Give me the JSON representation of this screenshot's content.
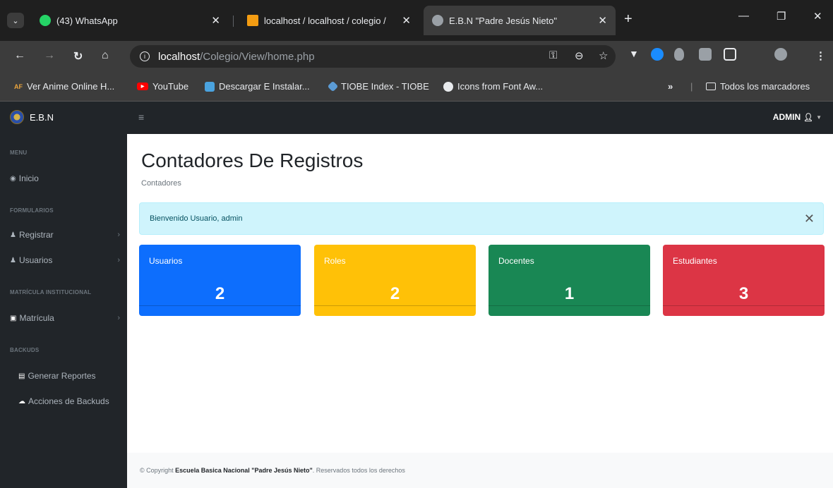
{
  "browser": {
    "tabs": [
      {
        "title": "(43) WhatsApp",
        "favicon_color": "#25d366"
      },
      {
        "title": "localhost / localhost / colegio /",
        "favicon_color": "#f39c12"
      },
      {
        "title": "E.B.N \"Padre Jesús Nieto\"",
        "favicon_color": "#9aa0a6"
      }
    ],
    "url_host": "localhost",
    "url_path": "/Colegio/View/home.php",
    "bookmarks": [
      {
        "label": "Ver Anime Online H...",
        "badge": "AF",
        "color": "#e8a33d"
      },
      {
        "label": "YouTube",
        "color": "#ff0000"
      },
      {
        "label": "Descargar E Instalar...",
        "color": "#4aa3df"
      },
      {
        "label": "TIOBE Index - TIOBE",
        "color": "#5b9bd5"
      },
      {
        "label": "Icons from Font Aw...",
        "color": "#e8eaed"
      }
    ],
    "bookmarks_overflow": "»",
    "all_bookmarks": "Todos los marcadores"
  },
  "app": {
    "brand": "E.B.N",
    "user_menu": "ADMIN",
    "sidebar": {
      "sections": [
        {
          "heading": "MENU",
          "items": [
            {
              "label": "Inicio",
              "icon": "dashboard-icon"
            }
          ]
        },
        {
          "heading": "FORMULARIOS",
          "items": [
            {
              "label": "Registrar",
              "icon": "user-icon",
              "expandable": true
            },
            {
              "label": "Usuarios",
              "icon": "users-icon",
              "expandable": true
            }
          ]
        },
        {
          "heading": "MATRÍCULA INSTITUCIONAL",
          "items": [
            {
              "label": "Matrícula",
              "icon": "clipboard-icon",
              "expandable": true
            }
          ]
        },
        {
          "heading": "BACKUDS",
          "items": [
            {
              "label": "Generar Reportes",
              "icon": "report-icon"
            },
            {
              "label": "Acciones de Backuds",
              "icon": "cloud-icon"
            }
          ]
        }
      ]
    },
    "page_title": "Contadores De Registros",
    "breadcrumb": "Contadores",
    "alert": "Bienvenido Usuario, admin",
    "cards": [
      {
        "label": "Usuarios",
        "value": "2",
        "color": "#0d6efd"
      },
      {
        "label": "Roles",
        "value": "2",
        "color": "#ffc107"
      },
      {
        "label": "Docentes",
        "value": "1",
        "color": "#198754"
      },
      {
        "label": "Estudiantes",
        "value": "3",
        "color": "#dc3545"
      }
    ],
    "footer": {
      "prefix": "© Copyright",
      "org": "Escuela Basica Nacional \"Padre Jesús Nieto\"",
      "suffix": ". Reservados todos los derechos"
    }
  }
}
